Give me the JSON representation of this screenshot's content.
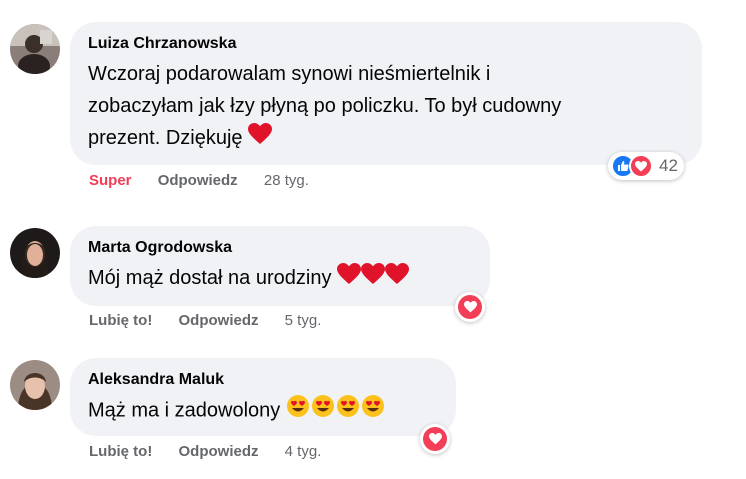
{
  "comments": [
    {
      "author": "Luiza Chrzanowska",
      "text_lines": [
        "Wczoraj podarowalam synowi nieśmiertelnik i",
        "zobaczyłam jak łzy płyną po policzku. To był cudowny",
        "prezent. Dziękuję"
      ],
      "trailing_emoji": "heart",
      "actions": {
        "react": "Super",
        "reply": "Odpowiedz",
        "time": "28 tyg."
      },
      "reaction_count": "42"
    },
    {
      "author": "Marta Ogrodowska",
      "text": "Mój mąż dostał na urodziny",
      "trailing_emoji": "heart x3",
      "actions": {
        "react": "Lubię to!",
        "reply": "Odpowiedz",
        "time": "5 tyg."
      }
    },
    {
      "author": "Aleksandra Maluk",
      "text": "Mąż ma i zadowolony",
      "trailing_emoji": "heart-eyes x4",
      "actions": {
        "react": "Lubię to!",
        "reply": "Odpowiedz",
        "time": "4 tyg."
      }
    }
  ],
  "colors": {
    "bubble": "#f0f2f5",
    "super": "#f33e58",
    "muted": "#65676b",
    "like_blue": "#1877f2"
  }
}
